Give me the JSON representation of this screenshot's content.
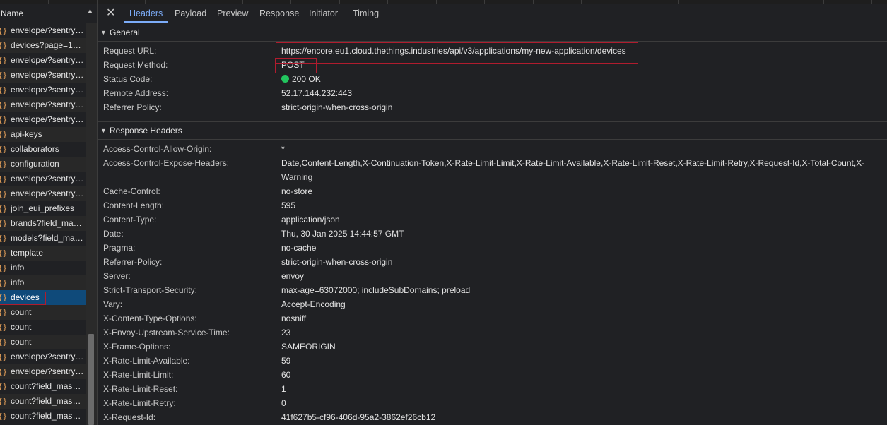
{
  "request_list": {
    "header": "Name",
    "items": [
      "envelope/?sentry_key=...",
      "devices?page=1&limit=...",
      "envelope/?sentry_key=...",
      "envelope/?sentry_key=...",
      "envelope/?sentry_key=...",
      "envelope/?sentry_key=...",
      "envelope/?sentry_key=...",
      "api-keys",
      "collaborators",
      "configuration",
      "envelope/?sentry_key=...",
      "envelope/?sentry_key=...",
      "join_eui_prefixes",
      "brands?field_mask=...",
      "models?field_mask=...",
      "template",
      "info",
      "info",
      "devices",
      "count",
      "count",
      "count",
      "envelope/?sentry_key=...",
      "envelope/?sentry_key=...",
      "count?field_mask=...",
      "count?field_mask=...",
      "count?field_mask=..."
    ],
    "selected_index": 18
  },
  "tabs": [
    "Headers",
    "Payload",
    "Preview",
    "Response",
    "Initiator",
    "Timing"
  ],
  "active_tab": "Headers",
  "general": {
    "title": "General",
    "rows": [
      {
        "k": "Request URL:",
        "v": "https://encore.eu1.cloud.thethings.industries/api/v3/applications/my-new-application/devices"
      },
      {
        "k": "Request Method:",
        "v": "POST"
      },
      {
        "k": "Status Code:",
        "v": "200 OK"
      },
      {
        "k": "Remote Address:",
        "v": "52.17.144.232:443"
      },
      {
        "k": "Referrer Policy:",
        "v": "strict-origin-when-cross-origin"
      }
    ]
  },
  "response_headers": {
    "title": "Response Headers",
    "rows": [
      {
        "k": "Access-Control-Allow-Origin:",
        "v": "*"
      },
      {
        "k": "Access-Control-Expose-Headers:",
        "v": "Date,Content-Length,X-Continuation-Token,X-Rate-Limit-Limit,X-Rate-Limit-Available,X-Rate-Limit-Reset,X-Rate-Limit-Retry,X-Request-Id,X-Total-Count,X-Warning"
      },
      {
        "k": "Cache-Control:",
        "v": "no-store"
      },
      {
        "k": "Content-Length:",
        "v": "595"
      },
      {
        "k": "Content-Type:",
        "v": "application/json"
      },
      {
        "k": "Date:",
        "v": "Thu, 30 Jan 2025 14:44:57 GMT"
      },
      {
        "k": "Pragma:",
        "v": "no-cache"
      },
      {
        "k": "Referrer-Policy:",
        "v": "strict-origin-when-cross-origin"
      },
      {
        "k": "Server:",
        "v": "envoy"
      },
      {
        "k": "Strict-Transport-Security:",
        "v": "max-age=63072000; includeSubDomains; preload"
      },
      {
        "k": "Vary:",
        "v": "Accept-Encoding"
      },
      {
        "k": "X-Content-Type-Options:",
        "v": "nosniff"
      },
      {
        "k": "X-Envoy-Upstream-Service-Time:",
        "v": "23"
      },
      {
        "k": "X-Frame-Options:",
        "v": "SAMEORIGIN"
      },
      {
        "k": "X-Rate-Limit-Available:",
        "v": "59"
      },
      {
        "k": "X-Rate-Limit-Limit:",
        "v": "60"
      },
      {
        "k": "X-Rate-Limit-Reset:",
        "v": "1"
      },
      {
        "k": "X-Rate-Limit-Retry:",
        "v": "0"
      },
      {
        "k": "X-Request-Id:",
        "v": "41f627b5-cf96-406d-95a2-3862ef26cb12"
      }
    ]
  },
  "icons": {
    "close": "close-icon",
    "sort": "sort-up-icon",
    "section": "collapse-triangle-icon",
    "request": "fetch-request-icon",
    "status": "status-success-dot"
  },
  "colors": {
    "accent": "#7cacf8",
    "highlight_box": "#b01c2e",
    "status_ok": "#22c55e",
    "selected_row": "#0f4a7a"
  }
}
